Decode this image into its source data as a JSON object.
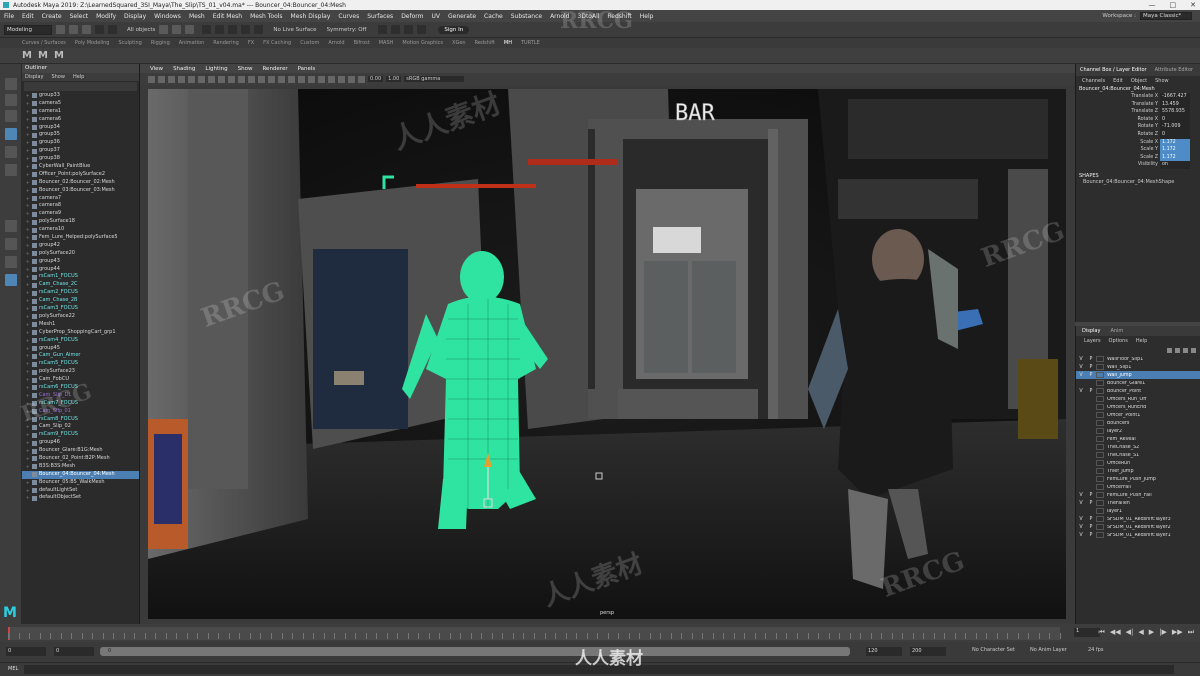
{
  "window": {
    "title": "Autodesk Maya 2019: Z:\\LearnedSquared_3SI_Maya\\The_Slip\\TS_01_v04.ma* --- Bouncer_04:Bouncer_04:Mesh",
    "controls": [
      "—",
      "□",
      "✕"
    ]
  },
  "menubar": {
    "items": [
      "File",
      "Edit",
      "Create",
      "Select",
      "Modify",
      "Display",
      "Windows",
      "Mesh",
      "Edit Mesh",
      "Mesh Tools",
      "Mesh Display",
      "Curves",
      "Surfaces",
      "Deform",
      "UV",
      "Generate",
      "Cache",
      "Substance",
      "Arnold",
      "3DtoAll",
      "Redshift",
      "Help"
    ],
    "workspace_label": "Workspace :",
    "workspace_value": "Maya Classic*"
  },
  "statusline": {
    "mode": "Modeling",
    "all_objects": "All objects",
    "live_surface": "No Live Surface",
    "symmetry": "Symmetry: Off",
    "signin": "Sign In"
  },
  "shelf": {
    "tabs": [
      "Curves / Surfaces",
      "Poly Modeling",
      "Sculpting",
      "Rigging",
      "Animation",
      "Rendering",
      "FX",
      "FX Caching",
      "Custom",
      "Arnold",
      "Bifrost",
      "MASH",
      "Motion Graphics",
      "XGen",
      "Redshift",
      "MH",
      "TURTLE"
    ],
    "active_tab": "MH",
    "buttons": [
      "M",
      "M",
      "M"
    ]
  },
  "outliner": {
    "title": "Outliner",
    "menu": [
      "Display",
      "Show",
      "Help"
    ],
    "rows": [
      {
        "label": "group33",
        "style": "normal"
      },
      {
        "label": "camera5",
        "style": "normal"
      },
      {
        "label": "camera1",
        "style": "normal"
      },
      {
        "label": "camera6",
        "style": "normal"
      },
      {
        "label": "group34",
        "style": "normal"
      },
      {
        "label": "group35",
        "style": "normal"
      },
      {
        "label": "group36",
        "style": "normal"
      },
      {
        "label": "group37",
        "style": "normal"
      },
      {
        "label": "group38",
        "style": "normal"
      },
      {
        "label": "CyberWall_PaintBlue",
        "style": "normal"
      },
      {
        "label": "Officer_Point:polySurface2",
        "style": "normal"
      },
      {
        "label": "Bouncer_02:Bouncer_02:Mesh",
        "style": "normal"
      },
      {
        "label": "Bouncer_03:Bouncer_03:Mesh",
        "style": "normal"
      },
      {
        "label": "camera7",
        "style": "normal"
      },
      {
        "label": "camera8",
        "style": "normal"
      },
      {
        "label": "camera9",
        "style": "normal"
      },
      {
        "label": "polySurface18",
        "style": "normal"
      },
      {
        "label": "camera10",
        "style": "normal"
      },
      {
        "label": "Fem_Lure_Helped:polySurface5",
        "style": "normal"
      },
      {
        "label": "group42",
        "style": "normal"
      },
      {
        "label": "polySurface20",
        "style": "normal"
      },
      {
        "label": "group43",
        "style": "normal"
      },
      {
        "label": "group44",
        "style": "normal"
      },
      {
        "label": "rsCam1_FOCUS",
        "style": "cyan"
      },
      {
        "label": "Cam_Chase_2C",
        "style": "cyan"
      },
      {
        "label": "rsCam2_FOCUS",
        "style": "cyan"
      },
      {
        "label": "Cam_Chase_2B",
        "style": "cyan"
      },
      {
        "label": "rsCam3_FOCUS",
        "style": "cyan"
      },
      {
        "label": "polySurface22",
        "style": "normal"
      },
      {
        "label": "Mesh1",
        "style": "normal"
      },
      {
        "label": "CyberProp_ShoppingCart_grp1",
        "style": "normal"
      },
      {
        "label": "rsCam4_FOCUS",
        "style": "cyan"
      },
      {
        "label": "group45",
        "style": "normal"
      },
      {
        "label": "Cam_Gun_Aimer",
        "style": "cyan"
      },
      {
        "label": "rsCam5_FOCUS",
        "style": "cyan"
      },
      {
        "label": "polySurface23",
        "style": "normal"
      },
      {
        "label": "Cam_FobCU",
        "style": "normal"
      },
      {
        "label": "rsCam6_FOCUS",
        "style": "cyan"
      },
      {
        "label": "Cam_Slip_DL",
        "style": "purple"
      },
      {
        "label": "rsCam7_FOCUS",
        "style": "cyan"
      },
      {
        "label": "Cam_Slip_01",
        "style": "purple"
      },
      {
        "label": "rsCam8_FOCUS",
        "style": "cyan"
      },
      {
        "label": "Cam_Slip_02",
        "style": "normal"
      },
      {
        "label": "rsCam9_FOCUS",
        "style": "cyan"
      },
      {
        "label": "group46",
        "style": "normal"
      },
      {
        "label": "Bouncer_Glare:B1G:Mesh",
        "style": "normal"
      },
      {
        "label": "Bouncer_02_Point:B2P:Mesh",
        "style": "normal"
      },
      {
        "label": "B3S:B3S:Mesh",
        "style": "normal"
      },
      {
        "label": "Bouncer_04:Bouncer_04:Mesh",
        "style": "selected"
      },
      {
        "label": "Bouncer_05:B5_WalkMesh",
        "style": "normal"
      },
      {
        "label": "defaultLightSet",
        "style": "normal"
      },
      {
        "label": "defaultObjectSet",
        "style": "normal"
      }
    ]
  },
  "viewport": {
    "menu": [
      "View",
      "Shading",
      "Lighting",
      "Show",
      "Renderer",
      "Panels"
    ],
    "near": "0.00",
    "far": "1.00",
    "colorspace": "sRGB gamma",
    "camera_label": "persp",
    "sign_text": "BAR"
  },
  "channelbox": {
    "tabs": [
      "Channel Box / Layer Editor",
      "Attribute Editor"
    ],
    "menu": [
      "Channels",
      "Edit",
      "Object",
      "Show"
    ],
    "object": "Bouncer_04:Bouncer_04:Mesh",
    "attributes": [
      {
        "name": "Translate X",
        "value": "-1667.427",
        "hi": false
      },
      {
        "name": "Translate Y",
        "value": "13.459",
        "hi": false
      },
      {
        "name": "Translate Z",
        "value": "5578.935",
        "hi": false
      },
      {
        "name": "Rotate X",
        "value": "0",
        "hi": false
      },
      {
        "name": "Rotate Y",
        "value": "-71.009",
        "hi": false
      },
      {
        "name": "Rotate Z",
        "value": "0",
        "hi": false
      },
      {
        "name": "Scale X",
        "value": "1.172",
        "hi": true
      },
      {
        "name": "Scale Y",
        "value": "1.172",
        "hi": true
      },
      {
        "name": "Scale Z",
        "value": "1.172",
        "hi": true
      },
      {
        "name": "Visibility",
        "value": "on",
        "hi": false
      }
    ],
    "shapes_title": "SHAPES",
    "shape_name": "Bouncer_04:Bouncer_04:MeshShape"
  },
  "layereditor": {
    "tabs": [
      "Display",
      "Anim"
    ],
    "menu": [
      "Layers",
      "Options",
      "Help"
    ],
    "layers": [
      {
        "v": "V",
        "p": "P",
        "name": "WallFloor_Slip1",
        "selected": false
      },
      {
        "v": "V",
        "p": "P",
        "name": "Wall_Slip1",
        "selected": false
      },
      {
        "v": "V",
        "p": "P",
        "name": "Wall_Jump",
        "selected": true
      },
      {
        "v": "",
        "p": "",
        "name": "Bouncer_Glare1",
        "selected": false
      },
      {
        "v": "V",
        "p": "P",
        "name": "Bouncer_Point",
        "selected": false
      },
      {
        "v": "",
        "p": "",
        "name": "Officers_Run_Off",
        "selected": false
      },
      {
        "v": "",
        "p": "",
        "name": "Officers_RunEnd",
        "selected": false
      },
      {
        "v": "",
        "p": "",
        "name": "Officer_Point1",
        "selected": false
      },
      {
        "v": "",
        "p": "",
        "name": "Bouncers",
        "selected": false
      },
      {
        "v": "",
        "p": "",
        "name": "layer2",
        "selected": false
      },
      {
        "v": "",
        "p": "",
        "name": "Fem_Reveal",
        "selected": false
      },
      {
        "v": "",
        "p": "",
        "name": "TheChase_S2",
        "selected": false
      },
      {
        "v": "",
        "p": "",
        "name": "TheChase_S1",
        "selected": false
      },
      {
        "v": "",
        "p": "",
        "name": "OfficeRun",
        "selected": false
      },
      {
        "v": "",
        "p": "",
        "name": "Thief_Jump",
        "selected": false
      },
      {
        "v": "",
        "p": "",
        "name": "FemLure_Push_Jump",
        "selected": false
      },
      {
        "v": "",
        "p": "",
        "name": "OfficerFall",
        "selected": false
      },
      {
        "v": "V",
        "p": "P",
        "name": "FemLure_Push_Fall",
        "selected": false
      },
      {
        "v": "V",
        "p": "P",
        "name": "TheFallen",
        "selected": false
      },
      {
        "v": "",
        "p": "",
        "name": "layer1",
        "selected": false
      },
      {
        "v": "V",
        "p": "P",
        "name": "SFSDM_01_Redshift:layer3",
        "selected": false
      },
      {
        "v": "V",
        "p": "P",
        "name": "SFSDM_01_Redshift:layer2",
        "selected": false
      },
      {
        "v": "V",
        "p": "P",
        "name": "SFSDM_01_Redshift:layer1",
        "selected": false
      }
    ]
  },
  "timeline": {
    "current_frame": "1",
    "playback_icons": [
      "⏮",
      "◀◀",
      "◀|",
      "◀",
      "▶",
      "|▶",
      "▶▶",
      "⏭"
    ]
  },
  "range": {
    "start": "0",
    "inner_start": "0",
    "bar_label": "0",
    "end_inner": "120",
    "end": "200",
    "character_set": "No Character Set",
    "anim_layer": "No Anim Layer",
    "fps": "24 fps"
  },
  "cmdline": {
    "label": "MEL"
  },
  "watermarks": [
    "RRCG",
    "人人素材",
    "RRCG",
    "人人素材",
    "RRCG",
    "RRCG",
    "人人素材",
    "RRCG"
  ],
  "colors": {
    "wireframe": "#2fe3a0",
    "selection": "#4b7fb3",
    "accent": "#2ad0e0"
  }
}
